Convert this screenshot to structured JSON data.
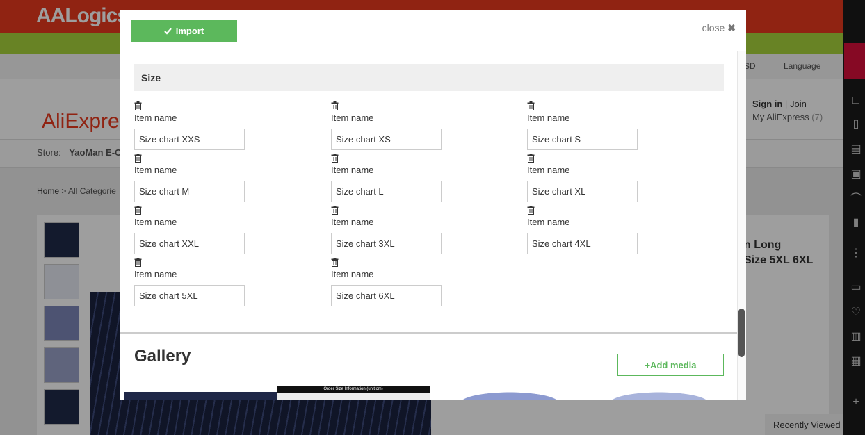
{
  "background": {
    "brand": "AALogics",
    "nav_items": [
      "SD",
      "Language"
    ],
    "logo": "AliExpre",
    "sign_in": "Sign in",
    "join": "Join",
    "my_aliexpress": "My AliExpress",
    "my_aliexpress_count": "(7)",
    "store_label": "Store:",
    "store_name": "YaoMan E-Co",
    "breadcrumb_home": "Home",
    "breadcrumb_sep": ">",
    "breadcrumb_all": "All Categorie",
    "product_title_line1": "n Long",
    "product_title_line2": "Size 5XL 6XL",
    "recently_viewed": "Recently Viewed"
  },
  "modal": {
    "import_label": "Import",
    "close_label": "close",
    "close_glyph": "✖",
    "section_title": "Size",
    "items": [
      {
        "label": "Item name",
        "value": "Size chart XXS"
      },
      {
        "label": "Item name",
        "value": "Size chart XS"
      },
      {
        "label": "Item name",
        "value": "Size chart S"
      },
      {
        "label": "Item name",
        "value": "Size chart M"
      },
      {
        "label": "Item name",
        "value": "Size chart L"
      },
      {
        "label": "Item name",
        "value": "Size chart XL"
      },
      {
        "label": "Item name",
        "value": "Size chart XXL"
      },
      {
        "label": "Item name",
        "value": "Size chart 3XL"
      },
      {
        "label": "Item name",
        "value": "Size chart 4XL"
      },
      {
        "label": "Item name",
        "value": "Size chart 5XL"
      },
      {
        "label": "Item name",
        "value": "Size chart 6XL"
      }
    ],
    "gallery_title": "Gallery",
    "add_media_label": "+Add media",
    "gallery_image_2_caption": "Order Size Information (unit:cm)"
  },
  "colors": {
    "import_green": "#5cb85c",
    "brand_red": "#e8391d"
  }
}
